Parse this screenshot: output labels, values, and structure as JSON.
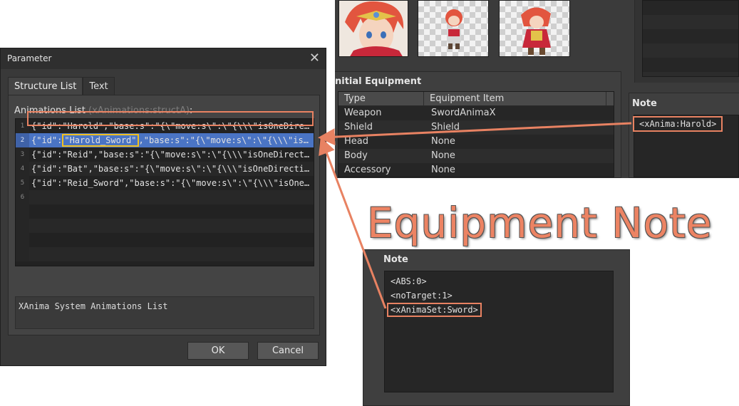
{
  "dialog": {
    "title": "Parameter",
    "close_glyph": "✕",
    "tabs": [
      "Structure List",
      "Text"
    ],
    "list_label": "Animations List",
    "list_hint": "(xAnimations:structA)",
    "list_colon": ":",
    "line_numbers": [
      "1",
      "2",
      "3",
      "4",
      "5",
      "6"
    ],
    "lines": [
      "{\"id\":\"Harold\",\"base:s\":\"{\\\"move:s\\\":\\\"{\\\\\\\"isOneDirec…",
      "",
      "{\"id\":\"Reid\",\"base:s\":\"{\\\"move:s\\\":\\\"{\\\\\\\"isOneDirecti…",
      "{\"id\":\"Bat\",\"base:s\":\"{\\\"move:s\\\":\\\"{\\\\\\\"isOneDirectio…",
      "{\"id\":\"Reid_Sword\",\"base:s\":\"{\\\"move:s\\\":\\\"{\\\\\\\"isOneD…",
      ""
    ],
    "selected_line": {
      "prefix": "{\"id\":",
      "id_value": "\"Harold_Sword\"",
      "suffix": ",\"base:s\":\"{\\\"move:s\\\":\\\"{\\\\\\\"isOn…"
    },
    "description": "XAnima System Animations List",
    "ok_label": "OK",
    "cancel_label": "Cancel"
  },
  "equipment": {
    "title": "nitial Equipment",
    "columns": [
      "Type",
      "Equipment Item"
    ],
    "rows": [
      {
        "type": "Weapon",
        "item": "SwordAnimaX"
      },
      {
        "type": "Shield",
        "item": "Shield"
      },
      {
        "type": "Head",
        "item": "None"
      },
      {
        "type": "Body",
        "item": "None"
      },
      {
        "type": "Accessory",
        "item": "None"
      }
    ]
  },
  "actor_note": {
    "title": "Note",
    "text": "<xAnima:Harold>"
  },
  "big_label": "Equipment Note",
  "item_note": {
    "title": "Note",
    "lines": [
      "<ABS:0>",
      "<noTarget:1>",
      "<xAnimaSet:Sword>"
    ]
  },
  "colors": {
    "accent": "#e88262",
    "selection": "#4a74c4",
    "id_highlight": "#f0c020"
  }
}
